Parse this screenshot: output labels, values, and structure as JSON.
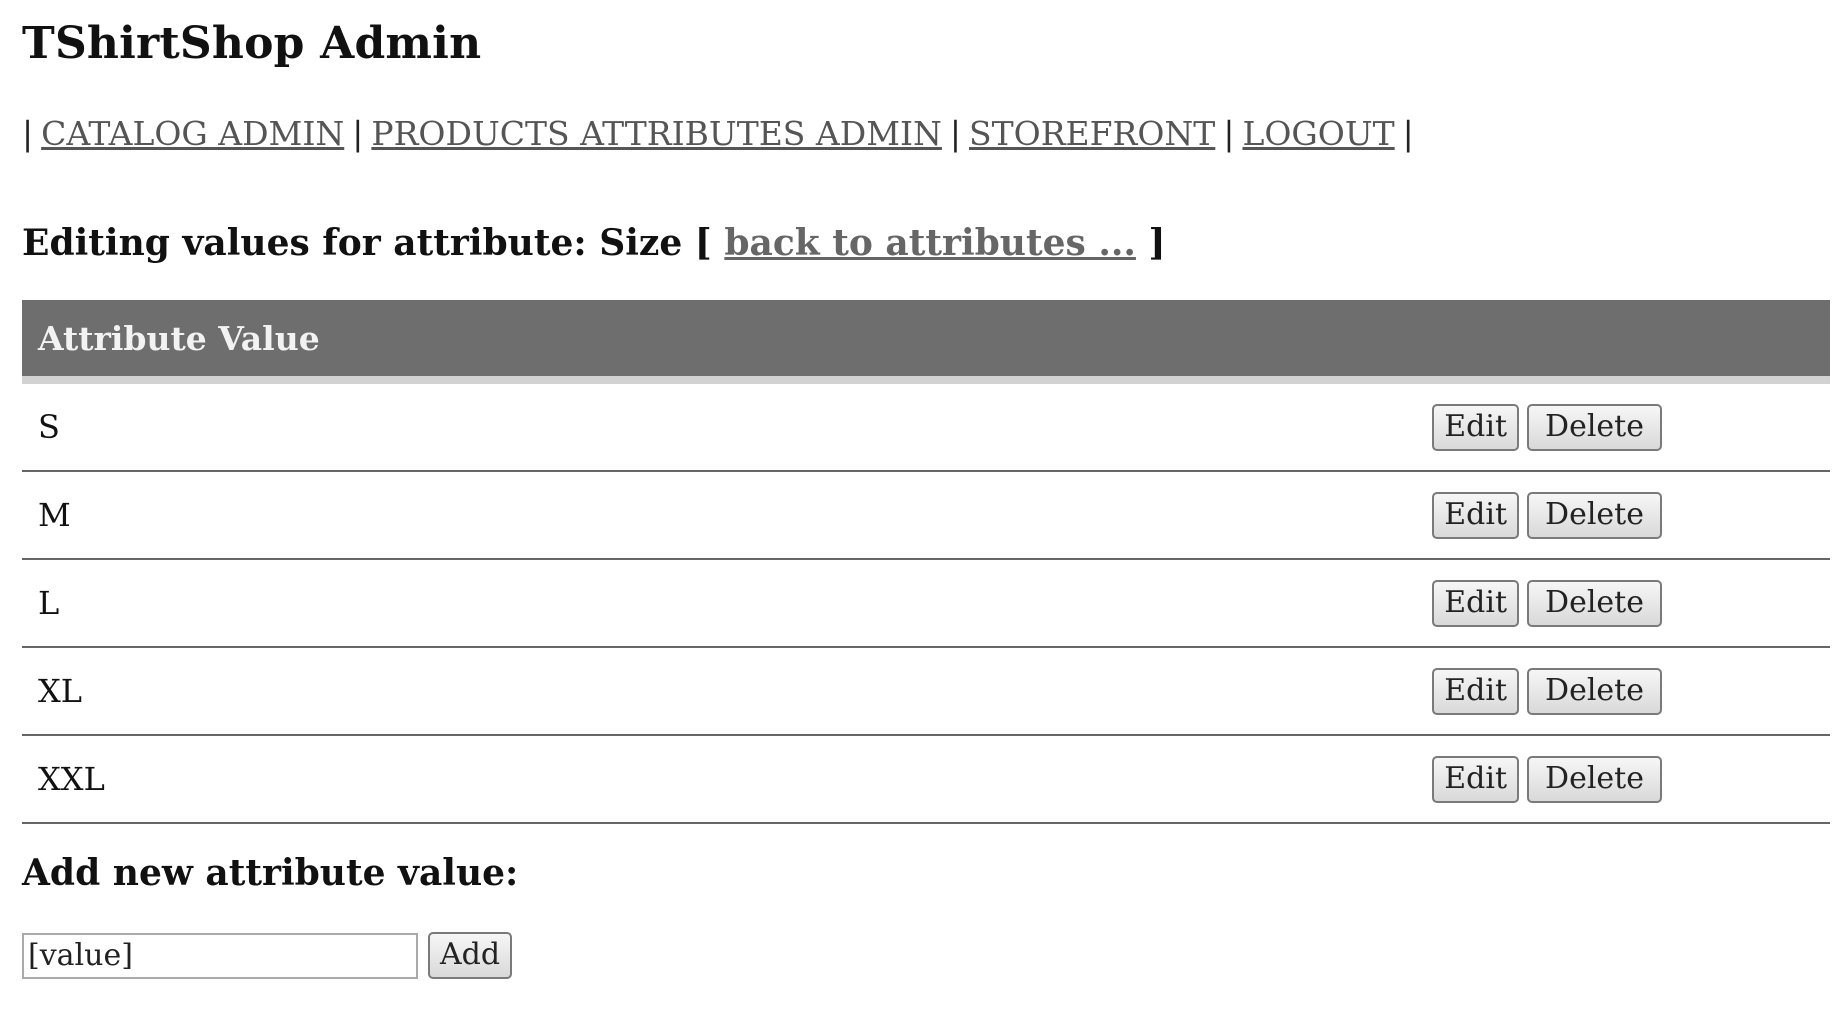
{
  "header": {
    "title": "TShirtShop Admin"
  },
  "menu": {
    "separator": "|",
    "items": [
      {
        "label": "CATALOG ADMIN"
      },
      {
        "label": "PRODUCTS ATTRIBUTES ADMIN"
      },
      {
        "label": "STOREFRONT"
      },
      {
        "label": "LOGOUT"
      }
    ]
  },
  "editing": {
    "prefix": "Editing values for attribute: Size [",
    "link": "back to attributes ...",
    "suffix": "]"
  },
  "table": {
    "header": "Attribute Value",
    "edit_label": "Edit",
    "delete_label": "Delete",
    "rows": [
      {
        "value": "S"
      },
      {
        "value": "M"
      },
      {
        "value": "L"
      },
      {
        "value": "XL"
      },
      {
        "value": "XXL"
      }
    ]
  },
  "add": {
    "heading": "Add new attribute value:",
    "input_value": "[value]",
    "button_label": "Add"
  }
}
